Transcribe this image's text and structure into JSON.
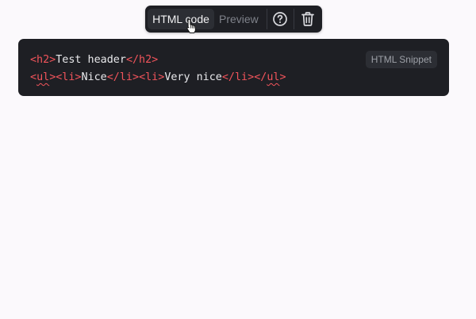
{
  "toolbar": {
    "html_code_label": "HTML code",
    "preview_label": "Preview",
    "help_icon": "question-circle-icon",
    "delete_icon": "trash-icon"
  },
  "code_block": {
    "lines": [
      [
        {
          "t": "<h2>",
          "c": "tag"
        },
        {
          "t": "Test header",
          "c": "text"
        },
        {
          "t": "</h2>",
          "c": "tag"
        }
      ],
      [
        {
          "t": "<",
          "c": "tag"
        },
        {
          "t": "ul",
          "c": "tag squig"
        },
        {
          "t": ">",
          "c": "tag"
        },
        {
          "t": "<li>",
          "c": "tag"
        },
        {
          "t": "Nice",
          "c": "text"
        },
        {
          "t": "</li>",
          "c": "tag"
        },
        {
          "t": "<li>",
          "c": "tag"
        },
        {
          "t": "Very nice",
          "c": "text"
        },
        {
          "t": "</li>",
          "c": "tag"
        },
        {
          "t": "</",
          "c": "tag"
        },
        {
          "t": "ul",
          "c": "tag squig"
        },
        {
          "t": ">",
          "c": "tag"
        }
      ]
    ],
    "language_badge": "HTML Snippet"
  },
  "colors": {
    "background": "#fbf9fc",
    "panel": "#1e1f24",
    "tag": "#f2545b",
    "text": "#e9e9ec",
    "muted": "#7f828a"
  }
}
